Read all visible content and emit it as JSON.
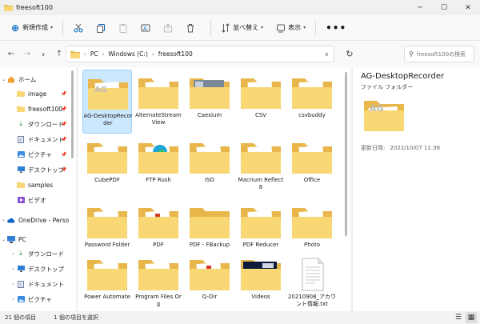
{
  "window": {
    "title": "freesoft100"
  },
  "toolbar": {
    "new_label": "新規作成",
    "sort_label": "並べ替え",
    "view_label": "表示",
    "more_label": "•••"
  },
  "address": {
    "crumbs": [
      "PC",
      "Windows (C:)",
      "freesoft100"
    ],
    "search_placeholder": "freesoft100の検索"
  },
  "nav": {
    "items": [
      {
        "label": "ホーム"
      },
      {
        "label": "image"
      },
      {
        "label": "freesoft100"
      },
      {
        "label": "ダウンロード"
      },
      {
        "label": "ドキュメント"
      },
      {
        "label": "ピクチャ"
      },
      {
        "label": "デスクトップ"
      },
      {
        "label": "samples"
      },
      {
        "label": "ビデオ"
      },
      {
        "label": "OneDrive - Perso"
      },
      {
        "label": "PC"
      },
      {
        "label": "ダウンロード"
      },
      {
        "label": "デスクトップ"
      },
      {
        "label": "ドキュメント"
      },
      {
        "label": "ピクチャ"
      }
    ]
  },
  "files": [
    {
      "name": "AG-DesktopRecorder",
      "kind": "folder-ag"
    },
    {
      "name": "AlternateStreamView",
      "kind": "folder-doc"
    },
    {
      "name": "Caesium",
      "kind": "folder-photo"
    },
    {
      "name": "CSV",
      "kind": "folder-doc"
    },
    {
      "name": "csvbuddy",
      "kind": "folder-doc"
    },
    {
      "name": "CubePDF",
      "kind": "folder-doc"
    },
    {
      "name": "FTP Rush",
      "kind": "folder-edge"
    },
    {
      "name": "ISO",
      "kind": "folder-doc"
    },
    {
      "name": "Macrium Reflect 8",
      "kind": "folder-doc"
    },
    {
      "name": "Office",
      "kind": "folder-doc"
    },
    {
      "name": "Password Folder",
      "kind": "folder-doc"
    },
    {
      "name": "PDF",
      "kind": "folder-pdf"
    },
    {
      "name": "PDF - FBackup",
      "kind": "folder"
    },
    {
      "name": "PDF Reducer",
      "kind": "folder-doc"
    },
    {
      "name": "Photo",
      "kind": "folder-doc"
    },
    {
      "name": "Power Automate",
      "kind": "folder-doc"
    },
    {
      "name": "Program Files Org",
      "kind": "folder-doc"
    },
    {
      "name": "Q-Dir",
      "kind": "folder-pdf"
    },
    {
      "name": "Videos",
      "kind": "folder-video"
    },
    {
      "name": "20210908_アカウント情報.txt",
      "kind": "txt"
    }
  ],
  "details": {
    "name": "AG-DesktopRecorder",
    "type": "ファイル フォルダー",
    "modified_label": "更新日時:",
    "modified_value": "2022/10/07 11:36"
  },
  "status": {
    "count": "21 個の項目",
    "selected": "1 個の項目を選択"
  },
  "colors": {
    "accent": "#0067c0",
    "folder": "#f8d775",
    "folder_back": "#e8b64a",
    "selection": "#cce8ff"
  }
}
